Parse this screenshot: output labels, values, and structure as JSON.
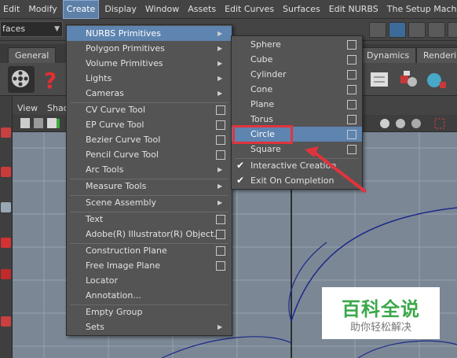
{
  "menubar": {
    "items": [
      "Edit",
      "Modify",
      "Create",
      "Display",
      "Window",
      "Assets",
      "Edit Curves",
      "Surfaces",
      "Edit NURBS",
      "The Setup Machine"
    ]
  },
  "statusline": {
    "mode_value": "faces"
  },
  "shelf": {
    "tabs": [
      "General",
      "Dynamics",
      "Renderin"
    ]
  },
  "panel": {
    "menu": [
      "View",
      "Shad"
    ]
  },
  "create_menu": {
    "items": [
      {
        "label": "NURBS Primitives",
        "kind": "submenu"
      },
      {
        "label": "Polygon Primitives",
        "kind": "submenu"
      },
      {
        "label": "Volume Primitives",
        "kind": "submenu"
      },
      {
        "label": "Lights",
        "kind": "submenu"
      },
      {
        "label": "Cameras",
        "kind": "submenu"
      },
      {
        "label": "CV Curve Tool",
        "kind": "option"
      },
      {
        "label": "EP Curve Tool",
        "kind": "option"
      },
      {
        "label": "Bezier Curve Tool",
        "kind": "option"
      },
      {
        "label": "Pencil Curve Tool",
        "kind": "option"
      },
      {
        "label": "Arc Tools",
        "kind": "submenu"
      },
      {
        "label": "Measure Tools",
        "kind": "submenu"
      },
      {
        "label": "Scene Assembly",
        "kind": "submenu"
      },
      {
        "label": "Text",
        "kind": "option"
      },
      {
        "label": "Adobe(R) Illustrator(R) Object...",
        "kind": "option"
      },
      {
        "label": "Construction Plane",
        "kind": "option"
      },
      {
        "label": "Free Image Plane",
        "kind": "option"
      },
      {
        "label": "Locator",
        "kind": "plain"
      },
      {
        "label": "Annotation...",
        "kind": "plain"
      },
      {
        "label": "Empty Group",
        "kind": "plain"
      },
      {
        "label": "Sets",
        "kind": "submenu"
      }
    ]
  },
  "nurbs_menu": {
    "items": [
      {
        "label": "Sphere"
      },
      {
        "label": "Cube"
      },
      {
        "label": "Cylinder"
      },
      {
        "label": "Cone"
      },
      {
        "label": "Plane"
      },
      {
        "label": "Torus"
      },
      {
        "label": "Circle"
      },
      {
        "label": "Square"
      }
    ],
    "toggles": [
      {
        "label": "Interactive Creation",
        "checked": true
      },
      {
        "label": "Exit On Completion",
        "checked": true
      }
    ]
  },
  "watermark": {
    "main": "百科全说",
    "sub": "助你轻松解决"
  },
  "colors": {
    "highlight": "#5e84b0",
    "annotation": "#e0343c",
    "viewport": "#7b8795"
  }
}
